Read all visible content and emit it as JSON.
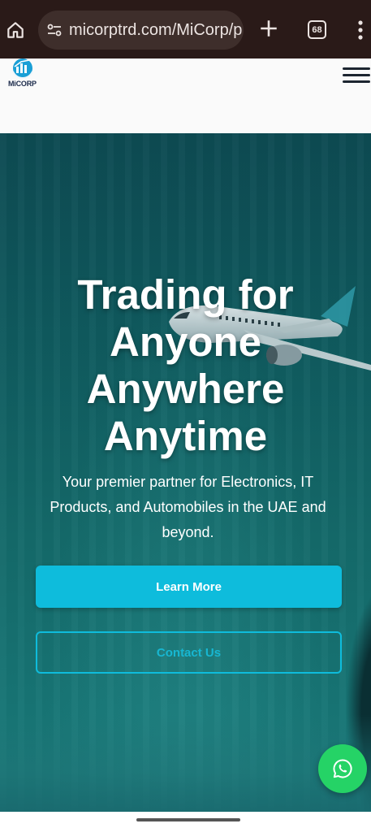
{
  "browser": {
    "url": "micorptrd.com/MiCorp/p",
    "tab_count": "68",
    "icons": {
      "home": "home-icon",
      "site_settings": "tune-icon",
      "new_tab": "plus-icon",
      "tabs": "tabs-icon",
      "menu": "more-vert-icon"
    }
  },
  "header": {
    "logo_text": "MiCORP",
    "menu_icon": "hamburger-icon"
  },
  "hero": {
    "title_lines": [
      "Trading for",
      "Anyone",
      "Anywhere",
      "Anytime"
    ],
    "subtitle": "Your premier partner for Electronics, IT Products, and Automobiles in the UAE and beyond.",
    "primary_button": "Learn More",
    "secondary_button": "Contact Us",
    "floating_icon": "whatsapp-icon"
  },
  "colors": {
    "accent": "#0ebcdc",
    "whatsapp": "#25d366",
    "hero_bg": "#146a6a",
    "chrome_bg": "#2a1a18"
  }
}
